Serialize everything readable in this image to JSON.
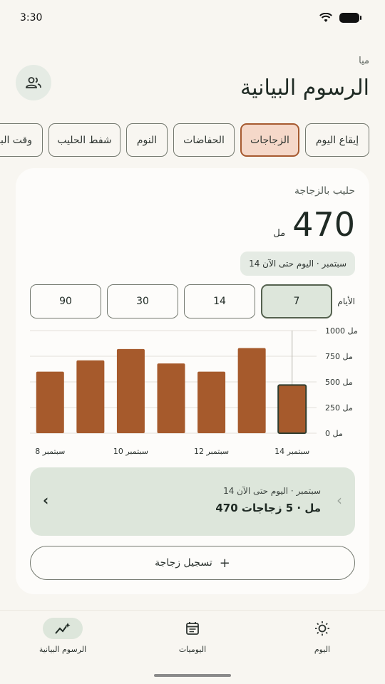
{
  "status": {
    "time": "3:30"
  },
  "header": {
    "subtitle": "ميا",
    "title": "الرسوم البيانية"
  },
  "chips": [
    {
      "label": "إيقاع اليوم",
      "active": false
    },
    {
      "label": "الزجاجات",
      "active": true
    },
    {
      "label": "الحفاضات",
      "active": false
    },
    {
      "label": "النوم",
      "active": false
    },
    {
      "label": "شفط الحليب",
      "active": false
    },
    {
      "label": "وقت البطن",
      "active": false
    }
  ],
  "card": {
    "label": "حليب بالزجاجة",
    "amount": "470",
    "unit": "مل",
    "range": "14 سبتمبر · اليوم حتى الآن",
    "days_label": "الأيام",
    "day_options": [
      "7",
      "14",
      "30",
      "90"
    ],
    "selected_days": "7"
  },
  "chart_data": {
    "type": "bar",
    "categories": [
      "8 سبتمبر",
      "9 سبتمبر",
      "10 سبتمبر",
      "11 سبتمبر",
      "12 سبتمبر",
      "13 سبتمبر",
      "14 سبتمبر"
    ],
    "values": [
      600,
      710,
      820,
      680,
      600,
      830,
      470
    ],
    "x_tick_labels": [
      "8 سبتمبر",
      "10 سبتمبر",
      "12 سبتمبر",
      "14 سبتمبر"
    ],
    "y_ticks": [
      "0 مل",
      "250 مل",
      "500 مل",
      "750 مل",
      "1000 مل"
    ],
    "ylim": [
      0,
      1000
    ],
    "highlighted": "14 سبتمبر",
    "bar_color": "#a65a2c",
    "grid": true
  },
  "summary": {
    "sub": "14 سبتمبر · اليوم حتى الآن",
    "main": "470 مل · 5 زجاجات"
  },
  "log_button": {
    "label": "تسجيل زجاجة"
  },
  "bottom_nav": [
    {
      "label": "الرسوم البيانية",
      "icon": "chart-sparkle-icon",
      "active": true
    },
    {
      "label": "اليوميات",
      "icon": "calendar-icon",
      "active": false
    },
    {
      "label": "اليوم",
      "icon": "sun-icon",
      "active": false
    }
  ],
  "colors": {
    "accent": "#a65a2c",
    "background": "#f8f6f1",
    "surface": "#fdfcfa",
    "selected_green": "#dde6db"
  }
}
